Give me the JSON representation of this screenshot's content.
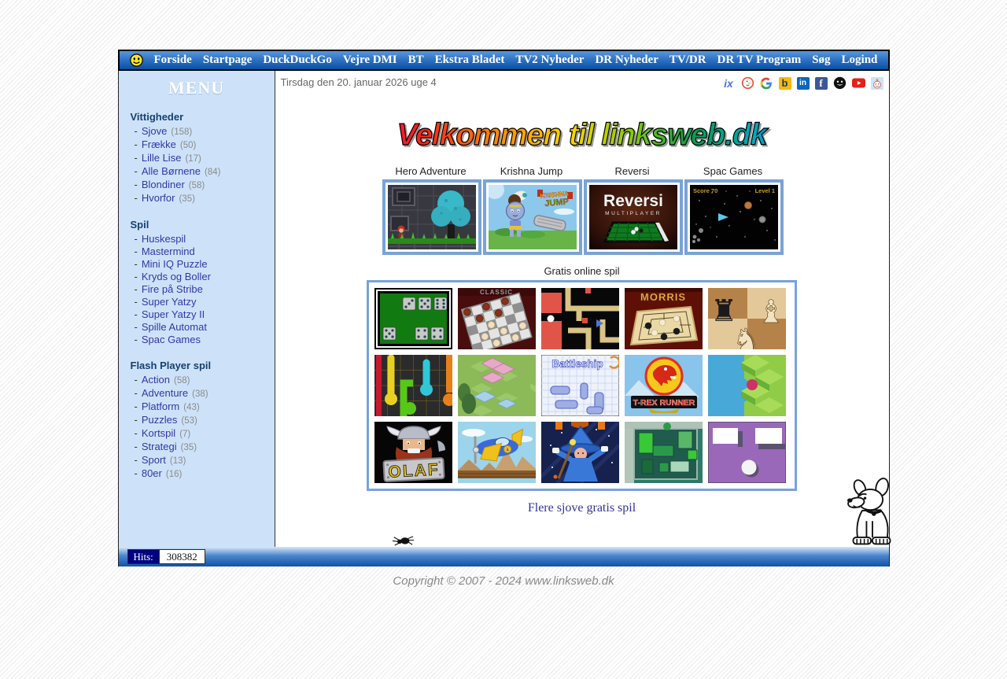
{
  "colors": {
    "nav_blue_top": "#5b97dc",
    "nav_blue_bottom": "#0b4fa5",
    "sidebar_bg": "#cde2f9",
    "link_navy": "#3237a8",
    "thumb_border": "#78a3d6",
    "hits_box_bg": "#000080"
  },
  "header": {
    "smiley_icon": "yellow-smiley",
    "links": [
      "Forside",
      "Startpage",
      "DuckDuckGo",
      "Vejre DMI",
      "BT",
      "Ekstra Bladet",
      "TV2 Nyheder",
      "DR Nyheder",
      "TV/DR",
      "DR TV Program",
      "Søg",
      "Logind"
    ]
  },
  "sidebar": {
    "title": "MENU",
    "dash": "-",
    "sections": [
      {
        "heading": "Vittigheder",
        "items": [
          {
            "label": "Sjove",
            "count": "(158)"
          },
          {
            "label": "Frække",
            "count": "(50)"
          },
          {
            "label": "Lille Lise",
            "count": "(17)"
          },
          {
            "label": "Alle Børnene",
            "count": "(84)"
          },
          {
            "label": "Blondiner",
            "count": "(58)"
          },
          {
            "label": "Hvorfor",
            "count": "(35)"
          }
        ]
      },
      {
        "heading": "Spil",
        "items": [
          {
            "label": "Huskespil"
          },
          {
            "label": "Mastermind"
          },
          {
            "label": "Mini IQ Puzzle"
          },
          {
            "label": "Kryds og Boller"
          },
          {
            "label": "Fire på Stribe"
          },
          {
            "label": "Super Yatzy"
          },
          {
            "label": "Super Yatzy II"
          },
          {
            "label": "Spille Automat"
          },
          {
            "label": "Spac Games"
          }
        ]
      },
      {
        "heading": "Flash Player spil",
        "items": [
          {
            "label": "Action",
            "count": "(58)"
          },
          {
            "label": "Adventure",
            "count": "(38)"
          },
          {
            "label": "Platform",
            "count": "(43)"
          },
          {
            "label": "Puzzles",
            "count": "(53)"
          },
          {
            "label": "Kortspil",
            "count": "(7)"
          },
          {
            "label": "Strategi",
            "count": "(35)"
          },
          {
            "label": "Sport",
            "count": "(13)"
          },
          {
            "label": "80er",
            "count": "(16)"
          }
        ]
      }
    ]
  },
  "main": {
    "date_line": "Tirsdag den 20. januar 2026 uge 4",
    "social_icons": [
      {
        "name": "ix",
        "glyph": "ix"
      },
      {
        "name": "duckduckgo"
      },
      {
        "name": "google"
      },
      {
        "name": "bing",
        "glyph": "b"
      },
      {
        "name": "linkedin",
        "glyph": "in"
      },
      {
        "name": "facebook",
        "glyph": "f"
      },
      {
        "name": "dark-smiley"
      },
      {
        "name": "youtube"
      },
      {
        "name": "reddit"
      }
    ],
    "welcome_title": "Velkommen til linksweb.dk",
    "featured": [
      {
        "label": "Hero Adventure"
      },
      {
        "label": "Krishna Jump",
        "art_line1": "KRISHNA",
        "art_line2": "JUMP"
      },
      {
        "label": "Reversi",
        "art_title": "Reversi",
        "art_sub": "MULTIPLAYER"
      },
      {
        "label": "Spac Games",
        "score": "Score 70",
        "level": "Level 1"
      }
    ],
    "grid": {
      "caption": "Gratis online spil",
      "tiles": [
        {
          "name": "yatzy-dice"
        },
        {
          "name": "checkers",
          "art_text": "CLASSIC"
        },
        {
          "name": "maze-game"
        },
        {
          "name": "nine-mens-morris",
          "art_text": "MORRIS"
        },
        {
          "name": "chess"
        },
        {
          "name": "flow-connect"
        },
        {
          "name": "isometric-puzzle"
        },
        {
          "name": "battleship",
          "art_text": "Battleship"
        },
        {
          "name": "t-rex-runner",
          "art_text": "T-REX RUNNER"
        },
        {
          "name": "zigzag-ball"
        },
        {
          "name": "olaf-viking",
          "art_text": "OLAF"
        },
        {
          "name": "airplane"
        },
        {
          "name": "wizard"
        },
        {
          "name": "blocks-puzzle"
        },
        {
          "name": "bounce-ball"
        }
      ]
    },
    "more_link": "Flere sjove gratis spil"
  },
  "hits": {
    "label": "Hits:",
    "value": "308382"
  },
  "copyright": "Copyright © 2007 - 2024 www.linksweb.dk"
}
